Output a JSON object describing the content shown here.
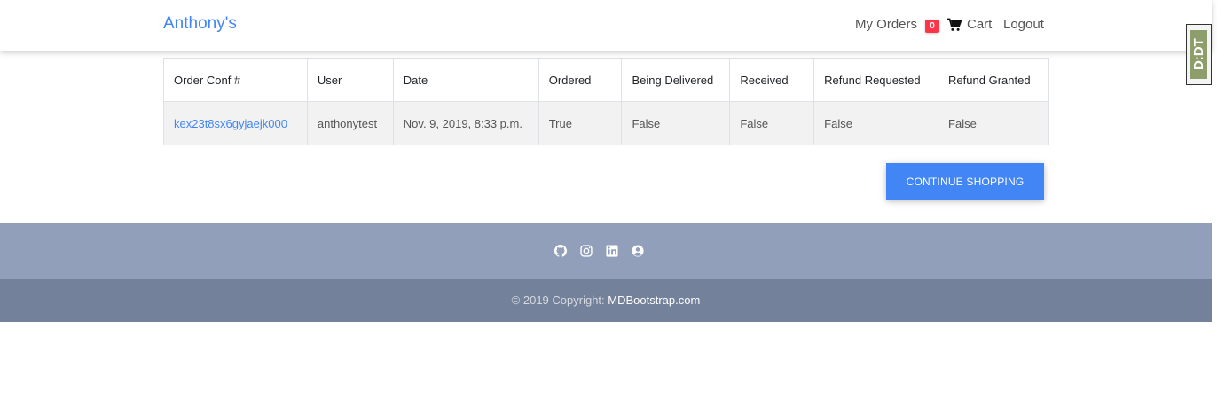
{
  "navbar": {
    "brand": "Anthony's",
    "my_orders": "My Orders",
    "cart_count": "0",
    "cart_label": "Cart",
    "logout": "Logout"
  },
  "extension_badge": {
    "label": "D:DT"
  },
  "orders_table": {
    "headers": [
      "Order Conf #",
      "User",
      "Date",
      "Ordered",
      "Being Delivered",
      "Received",
      "Refund Requested",
      "Refund Granted"
    ],
    "rows": [
      [
        "kex23t8sx6gyjaejk000",
        "anthonytest",
        "Nov. 9, 2019, 8:33 p.m.",
        "True",
        "False",
        "False",
        "False",
        "False"
      ]
    ]
  },
  "continue_button": "CONTINUE SHOPPING",
  "footer": {
    "social_icons": [
      "github-icon",
      "instagram-icon",
      "linkedin-icon",
      "user-circle-icon"
    ],
    "copyright_prefix": "© 2019 Copyright:",
    "copyright_link": "MDBootstrap.com"
  },
  "colors": {
    "accent": "#4285f4",
    "badge": "#ff3547",
    "footer_top": "#919fba",
    "footer_bottom": "#74819a"
  }
}
